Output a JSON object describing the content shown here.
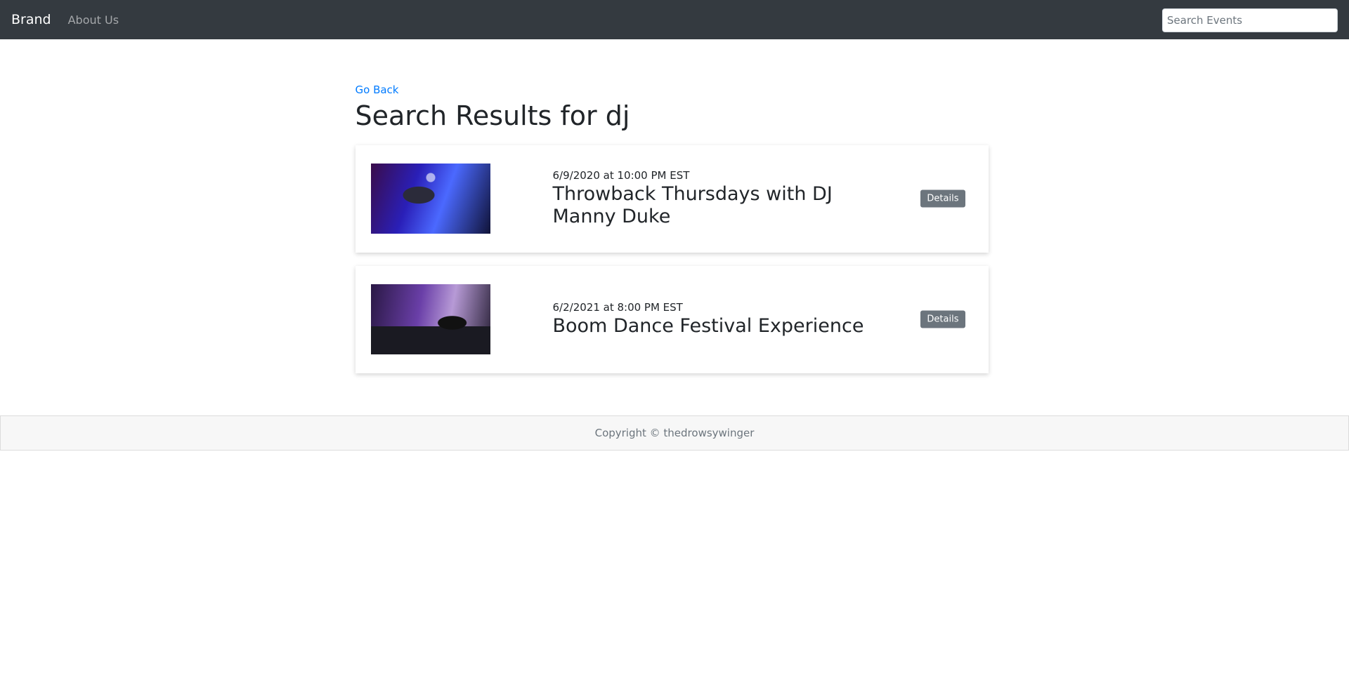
{
  "navbar": {
    "brand": "Brand",
    "links": [
      {
        "label": "About Us"
      }
    ],
    "search_placeholder": "Search Events"
  },
  "main": {
    "go_back": "Go Back",
    "title": "Search Results for dj",
    "results": [
      {
        "date": "6/9/2020 at 10:00 PM EST",
        "title": "Throwback Thursdays with DJ Manny Duke",
        "button": "Details",
        "image_icon": "dj-photo"
      },
      {
        "date": "6/2/2021 at 8:00 PM EST",
        "title": "Boom Dance Festival Experience",
        "button": "Details",
        "image_icon": "dj-photo"
      }
    ]
  },
  "footer": {
    "text": "Copyright © thedrowsywinger"
  },
  "colors": {
    "navbar_bg": "#343a40",
    "link": "#007bff",
    "button_bg": "#6c757d"
  }
}
